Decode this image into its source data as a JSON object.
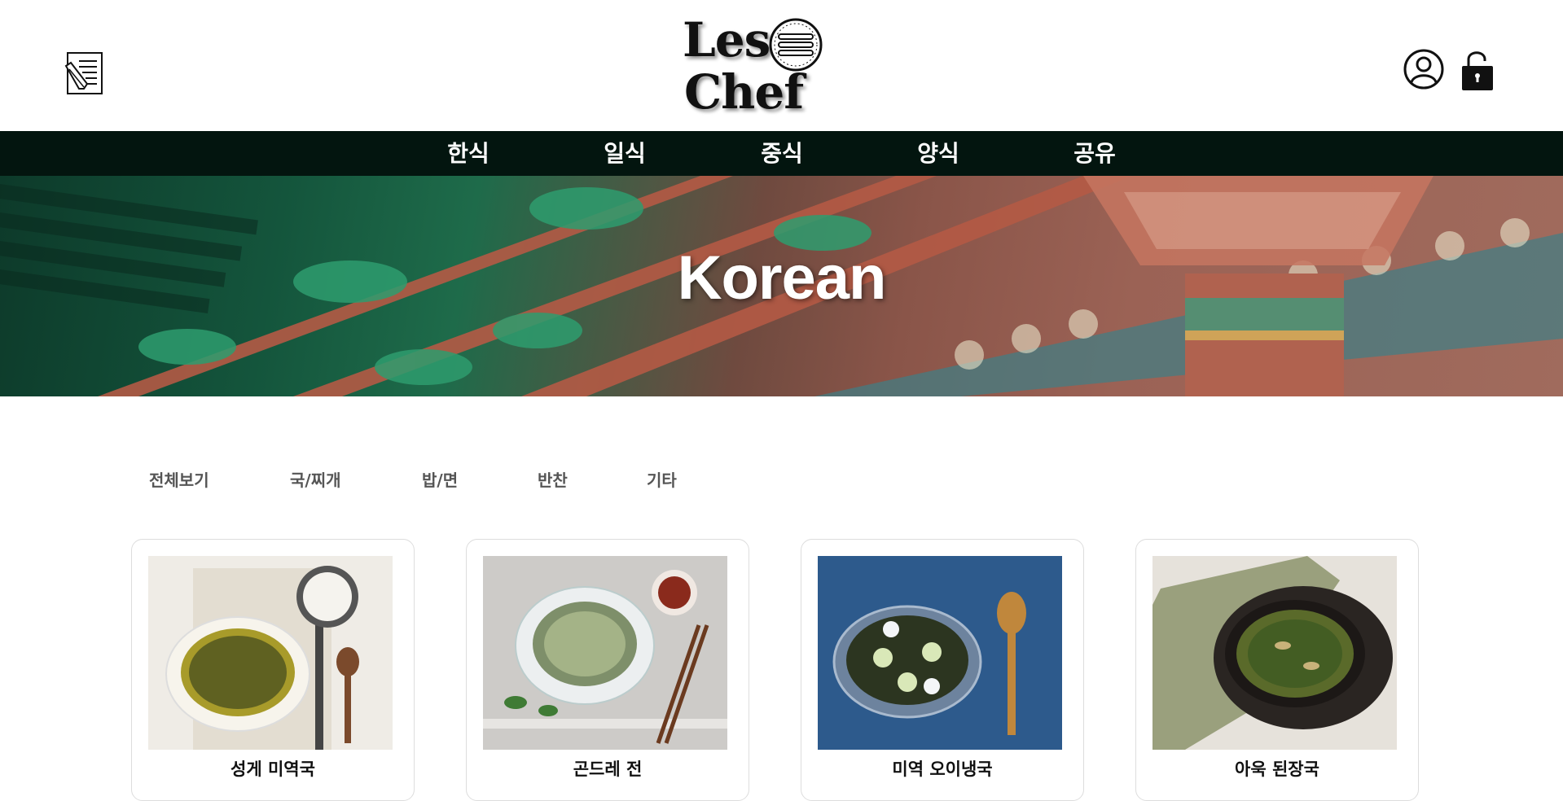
{
  "brand": {
    "logo_line1": "Les",
    "logo_line2": "Chef"
  },
  "header": {
    "recipe_icon": "recipe-note-icon",
    "user_icon": "user-icon",
    "lock_icon": "lock-icon"
  },
  "nav": {
    "items": [
      "한식",
      "일식",
      "중식",
      "양식",
      "공유"
    ]
  },
  "hero": {
    "title": "Korean"
  },
  "categories": [
    "전체보기",
    "국/찌개",
    "밥/면",
    "반찬",
    "기타"
  ],
  "recipes": [
    {
      "title": "성게 미역국",
      "bg": "#efece6"
    },
    {
      "title": "곤드레 전",
      "bg": "#cdcbc8"
    },
    {
      "title": "미역 오이냉국",
      "bg": "#2f5d8f"
    },
    {
      "title": "아욱 된장국",
      "bg": "#e6e2db"
    }
  ],
  "colors": {
    "nav_bg": "#03150f",
    "text": "#111111",
    "muted": "#555555"
  }
}
